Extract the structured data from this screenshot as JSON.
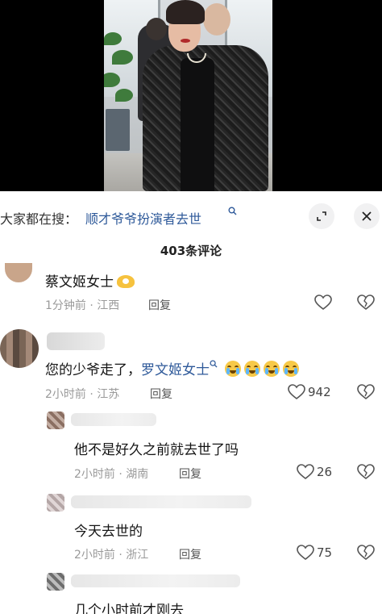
{
  "search": {
    "label": "大家都在搜：",
    "query": "顺才爷爷扮演者去世",
    "search_icon": "search-icon",
    "expand_icon": "expand-icon",
    "close_icon": "close-icon"
  },
  "comments_count": "403条评论",
  "comments": [
    {
      "text": "蔡文姬女士",
      "emoji": "heart-hands-emoji",
      "time": "1分钟前",
      "location": "江西",
      "reply_label": "回复",
      "likes": ""
    },
    {
      "text_prefix": "您的少爷走了，",
      "link": "罗文姬女士",
      "emoji": "crying-emoji",
      "time": "2小时前",
      "location": "江苏",
      "reply_label": "回复",
      "likes": "942"
    }
  ],
  "replies": [
    {
      "text": "他不是好久之前就去世了吗",
      "time": "2小时前",
      "location": "湖南",
      "reply_label": "回复",
      "likes": "26"
    },
    {
      "text": "今天去世的",
      "time": "2小时前",
      "location": "浙江",
      "reply_label": "回复",
      "likes": "75"
    },
    {
      "text": "几个小时前才刚去"
    }
  ],
  "sep": "·"
}
